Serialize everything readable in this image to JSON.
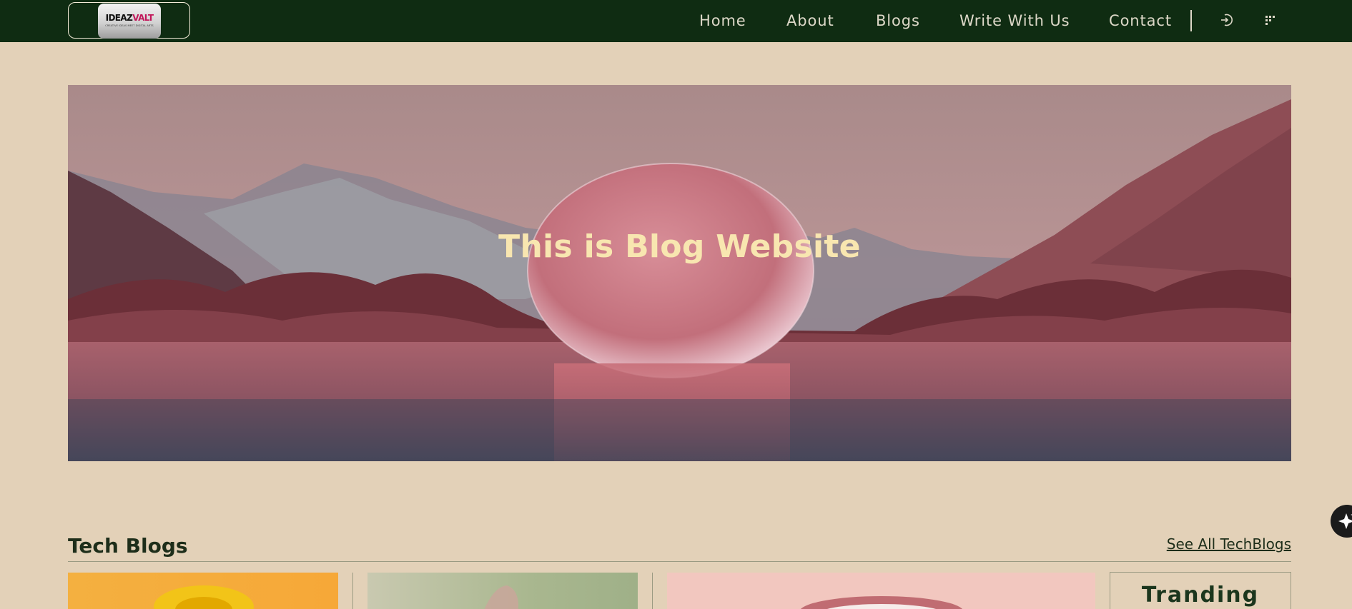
{
  "brand": {
    "logo_text_prefix": "IDEAZ",
    "logo_text_accent": "VALT",
    "logo_tagline": "CREATIVE IDEAS MEET DIGITAL ARTS"
  },
  "nav": {
    "links": [
      "Home",
      "About",
      "Blogs",
      "Write With Us",
      "Contact"
    ]
  },
  "icons": {
    "login": "login-icon",
    "menu": "grid-menu-icon",
    "ai": "sparkle-icon"
  },
  "hero": {
    "title": "This is Blog Website"
  },
  "tech_section": {
    "title": "Tech Blogs",
    "see_all": "See All TechBlogs"
  },
  "trending": {
    "title": "Tranding"
  },
  "colors": {
    "navbar": "#0f2c12",
    "page_bg": "#e3d1b8",
    "hero_text": "#f8e6b0",
    "nav_text": "#ddd8c8"
  }
}
